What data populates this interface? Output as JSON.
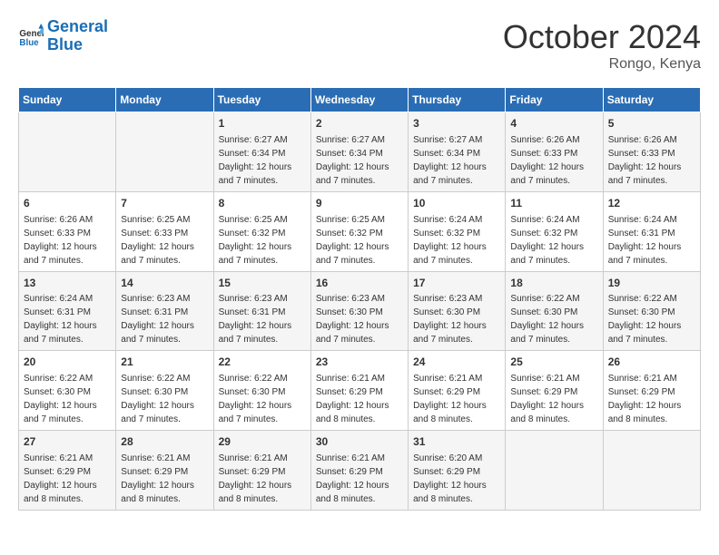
{
  "header": {
    "logo_line1": "General",
    "logo_line2": "Blue",
    "month": "October 2024",
    "location": "Rongo, Kenya"
  },
  "weekdays": [
    "Sunday",
    "Monday",
    "Tuesday",
    "Wednesday",
    "Thursday",
    "Friday",
    "Saturday"
  ],
  "weeks": [
    [
      {
        "day": "",
        "detail": ""
      },
      {
        "day": "",
        "detail": ""
      },
      {
        "day": "1",
        "detail": "Sunrise: 6:27 AM\nSunset: 6:34 PM\nDaylight: 12 hours and 7 minutes."
      },
      {
        "day": "2",
        "detail": "Sunrise: 6:27 AM\nSunset: 6:34 PM\nDaylight: 12 hours and 7 minutes."
      },
      {
        "day": "3",
        "detail": "Sunrise: 6:27 AM\nSunset: 6:34 PM\nDaylight: 12 hours and 7 minutes."
      },
      {
        "day": "4",
        "detail": "Sunrise: 6:26 AM\nSunset: 6:33 PM\nDaylight: 12 hours and 7 minutes."
      },
      {
        "day": "5",
        "detail": "Sunrise: 6:26 AM\nSunset: 6:33 PM\nDaylight: 12 hours and 7 minutes."
      }
    ],
    [
      {
        "day": "6",
        "detail": "Sunrise: 6:26 AM\nSunset: 6:33 PM\nDaylight: 12 hours and 7 minutes."
      },
      {
        "day": "7",
        "detail": "Sunrise: 6:25 AM\nSunset: 6:33 PM\nDaylight: 12 hours and 7 minutes."
      },
      {
        "day": "8",
        "detail": "Sunrise: 6:25 AM\nSunset: 6:32 PM\nDaylight: 12 hours and 7 minutes."
      },
      {
        "day": "9",
        "detail": "Sunrise: 6:25 AM\nSunset: 6:32 PM\nDaylight: 12 hours and 7 minutes."
      },
      {
        "day": "10",
        "detail": "Sunrise: 6:24 AM\nSunset: 6:32 PM\nDaylight: 12 hours and 7 minutes."
      },
      {
        "day": "11",
        "detail": "Sunrise: 6:24 AM\nSunset: 6:32 PM\nDaylight: 12 hours and 7 minutes."
      },
      {
        "day": "12",
        "detail": "Sunrise: 6:24 AM\nSunset: 6:31 PM\nDaylight: 12 hours and 7 minutes."
      }
    ],
    [
      {
        "day": "13",
        "detail": "Sunrise: 6:24 AM\nSunset: 6:31 PM\nDaylight: 12 hours and 7 minutes."
      },
      {
        "day": "14",
        "detail": "Sunrise: 6:23 AM\nSunset: 6:31 PM\nDaylight: 12 hours and 7 minutes."
      },
      {
        "day": "15",
        "detail": "Sunrise: 6:23 AM\nSunset: 6:31 PM\nDaylight: 12 hours and 7 minutes."
      },
      {
        "day": "16",
        "detail": "Sunrise: 6:23 AM\nSunset: 6:30 PM\nDaylight: 12 hours and 7 minutes."
      },
      {
        "day": "17",
        "detail": "Sunrise: 6:23 AM\nSunset: 6:30 PM\nDaylight: 12 hours and 7 minutes."
      },
      {
        "day": "18",
        "detail": "Sunrise: 6:22 AM\nSunset: 6:30 PM\nDaylight: 12 hours and 7 minutes."
      },
      {
        "day": "19",
        "detail": "Sunrise: 6:22 AM\nSunset: 6:30 PM\nDaylight: 12 hours and 7 minutes."
      }
    ],
    [
      {
        "day": "20",
        "detail": "Sunrise: 6:22 AM\nSunset: 6:30 PM\nDaylight: 12 hours and 7 minutes."
      },
      {
        "day": "21",
        "detail": "Sunrise: 6:22 AM\nSunset: 6:30 PM\nDaylight: 12 hours and 7 minutes."
      },
      {
        "day": "22",
        "detail": "Sunrise: 6:22 AM\nSunset: 6:30 PM\nDaylight: 12 hours and 7 minutes."
      },
      {
        "day": "23",
        "detail": "Sunrise: 6:21 AM\nSunset: 6:29 PM\nDaylight: 12 hours and 8 minutes."
      },
      {
        "day": "24",
        "detail": "Sunrise: 6:21 AM\nSunset: 6:29 PM\nDaylight: 12 hours and 8 minutes."
      },
      {
        "day": "25",
        "detail": "Sunrise: 6:21 AM\nSunset: 6:29 PM\nDaylight: 12 hours and 8 minutes."
      },
      {
        "day": "26",
        "detail": "Sunrise: 6:21 AM\nSunset: 6:29 PM\nDaylight: 12 hours and 8 minutes."
      }
    ],
    [
      {
        "day": "27",
        "detail": "Sunrise: 6:21 AM\nSunset: 6:29 PM\nDaylight: 12 hours and 8 minutes."
      },
      {
        "day": "28",
        "detail": "Sunrise: 6:21 AM\nSunset: 6:29 PM\nDaylight: 12 hours and 8 minutes."
      },
      {
        "day": "29",
        "detail": "Sunrise: 6:21 AM\nSunset: 6:29 PM\nDaylight: 12 hours and 8 minutes."
      },
      {
        "day": "30",
        "detail": "Sunrise: 6:21 AM\nSunset: 6:29 PM\nDaylight: 12 hours and 8 minutes."
      },
      {
        "day": "31",
        "detail": "Sunrise: 6:20 AM\nSunset: 6:29 PM\nDaylight: 12 hours and 8 minutes."
      },
      {
        "day": "",
        "detail": ""
      },
      {
        "day": "",
        "detail": ""
      }
    ]
  ]
}
